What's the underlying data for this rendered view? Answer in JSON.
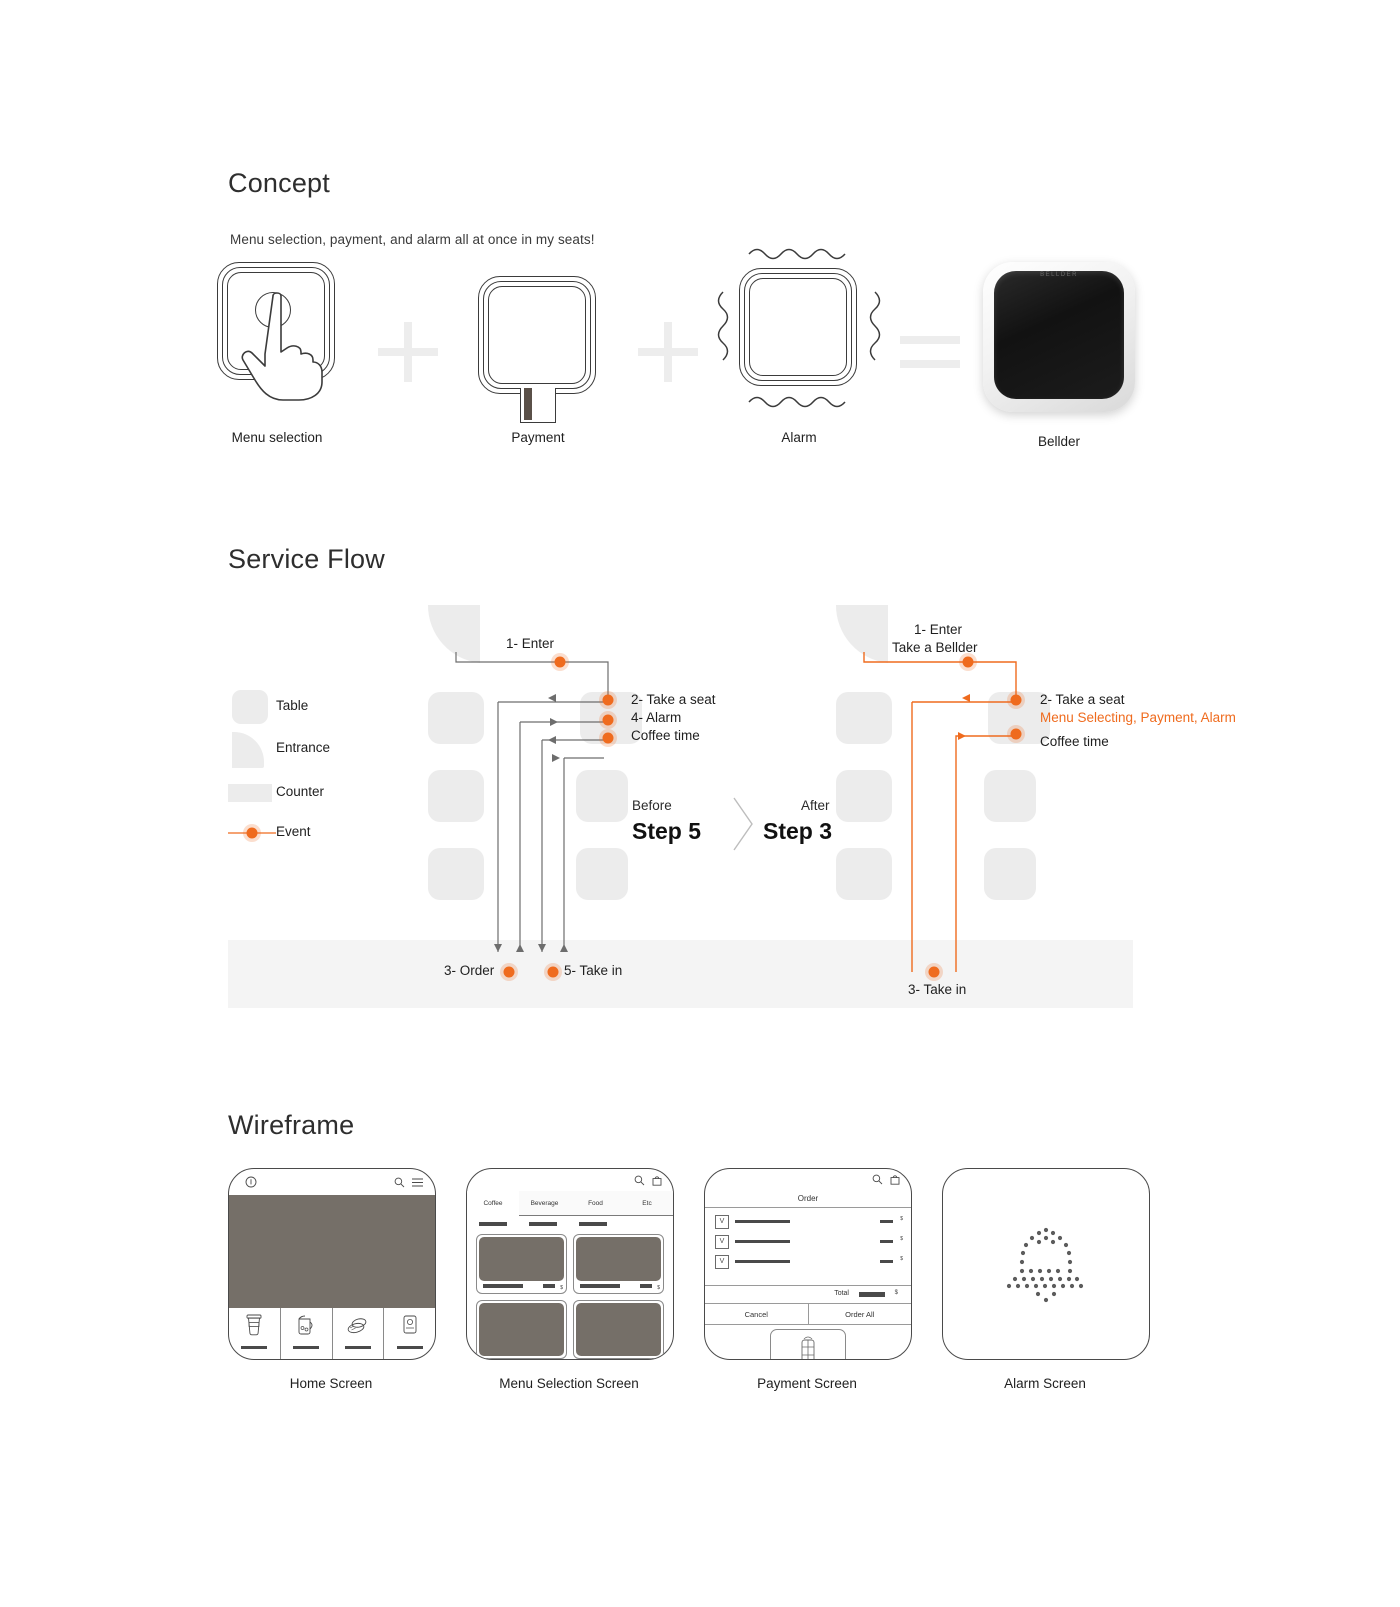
{
  "colors": {
    "accent": "#ef6b1e",
    "ink": "#2b2b2b",
    "gray_fill": "#ececec",
    "card_gray": "#756f68"
  },
  "sections": {
    "concept": {
      "title": "Concept",
      "subtitle": "Menu selection, payment, and alarm all at once in my seats!"
    },
    "service_flow": {
      "title": "Service Flow"
    },
    "wireframe": {
      "title": "Wireframe"
    }
  },
  "concept": {
    "items": [
      {
        "caption": "Menu selection",
        "icon": "touch-square-icon"
      },
      {
        "caption": "Payment",
        "icon": "card-reader-square-icon"
      },
      {
        "caption": "Alarm",
        "icon": "vibrating-square-icon"
      },
      {
        "caption": "Bellder",
        "icon": "bellder-device",
        "brand": "BELLDER"
      }
    ],
    "operators": [
      "+",
      "+",
      "="
    ]
  },
  "service_flow": {
    "legend": [
      {
        "label": "Table",
        "swatch": "table-swatch"
      },
      {
        "label": "Entrance",
        "swatch": "entrance-swatch"
      },
      {
        "label": "Counter",
        "swatch": "counter-swatch"
      },
      {
        "label": "Event",
        "swatch": "event-dot"
      }
    ],
    "before": {
      "phase_label": "Before",
      "step_label": "Step 5",
      "events": [
        {
          "label": "1- Enter"
        },
        {
          "label": "2- Take a seat"
        },
        {
          "label": "4- Alarm"
        },
        {
          "label": "Coffee time"
        },
        {
          "label": "3- Order"
        },
        {
          "label": "5- Take in"
        }
      ]
    },
    "after": {
      "phase_label": "After",
      "step_label": "Step 3",
      "events": [
        {
          "label": "1- Enter"
        },
        {
          "label": "Take a ",
          "highlight": "Bellder"
        },
        {
          "label": "2- Take a seat"
        },
        {
          "label": "Menu Selecting, Payment, Alarm",
          "accent": true
        },
        {
          "label": "Coffee time"
        },
        {
          "label": "3- Take in"
        }
      ]
    }
  },
  "wireframe": {
    "screens": [
      {
        "caption": "Home Screen",
        "topbar": {
          "left_icon": "info-icon",
          "right_icons": [
            "search-icon",
            "menu-icon"
          ]
        },
        "bottom_nav": [
          "coffee-cup-icon",
          "juice-pitcher-icon",
          "cookie-icon",
          "canned-drink-icon"
        ]
      },
      {
        "caption": "Menu Selection Screen",
        "topbar": {
          "right_icons": [
            "search-icon",
            "bag-icon"
          ]
        },
        "tabs": [
          "Coffee",
          "Beverage",
          "Food",
          "Etc"
        ],
        "selected_tab": "Coffee",
        "cards": [
          {
            "price_symbol": "$"
          },
          {
            "price_symbol": "$"
          },
          {
            "price_symbol": "$"
          },
          {
            "price_symbol": "$"
          }
        ]
      },
      {
        "caption": "Payment Screen",
        "topbar": {
          "right_icons": [
            "search-icon",
            "bag-icon"
          ]
        },
        "title": "Order",
        "rows": [
          {
            "checkbox": "V",
            "price_symbol": "$"
          },
          {
            "checkbox": "V",
            "price_symbol": "$"
          },
          {
            "checkbox": "V",
            "price_symbol": "$"
          }
        ],
        "total_label": "Total",
        "total_symbol": "$",
        "buttons": [
          "Cancel",
          "Order All"
        ],
        "card_icon": "sim-chip-icon"
      },
      {
        "caption": "Alarm Screen",
        "icon": "dotted-bell-icon"
      }
    ]
  }
}
